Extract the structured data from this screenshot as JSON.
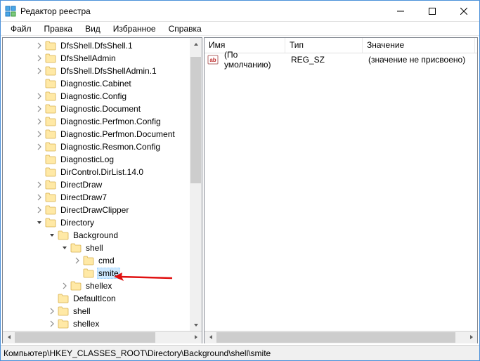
{
  "title": "Редактор реестра",
  "menu": {
    "file": "Файл",
    "edit": "Правка",
    "view": "Вид",
    "favorites": "Избранное",
    "help": "Справка"
  },
  "tree": {
    "items": [
      {
        "label": "DfsShell.DfsShell.1",
        "indent": 46,
        "exp": "right"
      },
      {
        "label": "DfsShellAdmin",
        "indent": 46,
        "exp": "right"
      },
      {
        "label": "DfsShell.DfsShellAdmin.1",
        "indent": 46,
        "exp": "right"
      },
      {
        "label": "Diagnostic.Cabinet",
        "indent": 46,
        "exp": "none"
      },
      {
        "label": "Diagnostic.Config",
        "indent": 46,
        "exp": "right"
      },
      {
        "label": "Diagnostic.Document",
        "indent": 46,
        "exp": "right"
      },
      {
        "label": "Diagnostic.Perfmon.Config",
        "indent": 46,
        "exp": "right"
      },
      {
        "label": "Diagnostic.Perfmon.Document",
        "indent": 46,
        "exp": "right"
      },
      {
        "label": "Diagnostic.Resmon.Config",
        "indent": 46,
        "exp": "right"
      },
      {
        "label": "DiagnosticLog",
        "indent": 46,
        "exp": "none"
      },
      {
        "label": "DirControl.DirList.14.0",
        "indent": 46,
        "exp": "none"
      },
      {
        "label": "DirectDraw",
        "indent": 46,
        "exp": "right"
      },
      {
        "label": "DirectDraw7",
        "indent": 46,
        "exp": "right"
      },
      {
        "label": "DirectDrawClipper",
        "indent": 46,
        "exp": "right"
      },
      {
        "label": "Directory",
        "indent": 46,
        "exp": "down"
      },
      {
        "label": "Background",
        "indent": 64,
        "exp": "down"
      },
      {
        "label": "shell",
        "indent": 82,
        "exp": "down"
      },
      {
        "label": "cmd",
        "indent": 100,
        "exp": "right"
      },
      {
        "label": "smite",
        "indent": 100,
        "exp": "none",
        "selected": true
      },
      {
        "label": "shellex",
        "indent": 82,
        "exp": "right"
      },
      {
        "label": "DefaultIcon",
        "indent": 64,
        "exp": "none"
      },
      {
        "label": "shell",
        "indent": 64,
        "exp": "right"
      },
      {
        "label": "shellex",
        "indent": 64,
        "exp": "right"
      }
    ]
  },
  "list": {
    "cols": {
      "name": "Имя",
      "type": "Тип",
      "value": "Значение"
    },
    "widths": {
      "name": 115,
      "type": 110,
      "value": 160
    },
    "rows": [
      {
        "name": "(По умолчанию)",
        "type": "REG_SZ",
        "value": "(значение не присвоено)"
      }
    ]
  },
  "statusbar": "Компьютер\\HKEY_CLASSES_ROOT\\Directory\\Background\\shell\\smite"
}
